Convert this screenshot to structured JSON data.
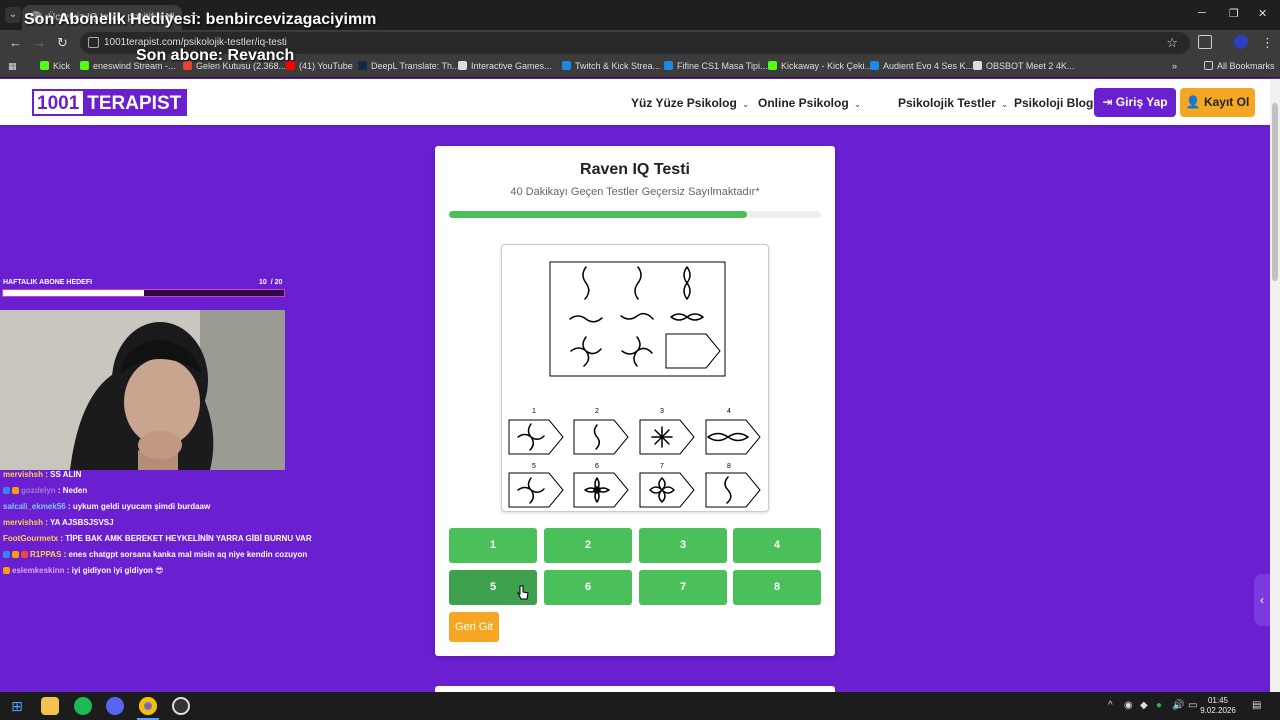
{
  "browser": {
    "tab_title": "Ücretsiz IQ testi - pozitif testi",
    "url": "1001terapist.com/psikolojik-testler/iq-testi",
    "bookmarks": [
      {
        "label": "Kick",
        "color": "#53fc18"
      },
      {
        "label": "eneswind Stream -...",
        "color": "#53fc18"
      },
      {
        "label": "Gelen Kutusu (2.368...",
        "color": "#ea4335"
      },
      {
        "label": "(41) YouTube",
        "color": "#ff0000"
      },
      {
        "label": "DeepL Translate: Th...",
        "color": "#0f2b46"
      },
      {
        "label": "Interactive Games...",
        "color": "#dddddd"
      },
      {
        "label": "Twitch & Kick Strea...",
        "color": "#1e88e5"
      },
      {
        "label": "Fifine CS1 Masa Tipi...",
        "color": "#1e88e5"
      },
      {
        "label": "Kickaway - Kick Çeki...",
        "color": "#53fc18"
      },
      {
        "label": "Audient Evo 4 Ses K...",
        "color": "#1e88e5"
      },
      {
        "label": "OBSBOT Meet 2 4K...",
        "color": "#dddddd"
      }
    ],
    "all_bookmarks": "All Bookmarks"
  },
  "site": {
    "logo_part1": "1001",
    "logo_part2": "TERAPIST",
    "menu": [
      "Yüz Yüze Psikolog",
      "Online Psikolog",
      "Psikolojik Testler",
      "Psikoloji Blog"
    ],
    "login": "Giriş Yap",
    "register": "Kayıt Ol",
    "brand_color": "#6a1fd0",
    "accent_color": "#f5a623"
  },
  "test": {
    "title": "Raven IQ Testi",
    "subtitle": "40 Dakikayı Geçen Testler Geçersiz Sayılmaktadır*",
    "progress": 0.8,
    "option_labels": [
      "1",
      "2",
      "3",
      "4",
      "5",
      "6",
      "7",
      "8"
    ],
    "answers": [
      "1",
      "2",
      "3",
      "4",
      "5",
      "6",
      "7",
      "8"
    ],
    "back": "Geri Git",
    "answer_color": "#4bbf5a"
  },
  "stream": {
    "gift_banner": "Son Abonelik Hediyesi: benbircevizagaciyimm",
    "last_sub": "Son abone: Revanch",
    "goal_label": "HAFTALIK ABONE HEDEFI",
    "goal_current": "10",
    "goal_total": "/ 20",
    "goal_progress": 0.5,
    "chat": [
      {
        "user": "mervishsh",
        "msg": "SS ALIN",
        "color": "#ffd24a"
      },
      {
        "user": "gozdelyn",
        "msg": "Neden",
        "color": "#a07ad8"
      },
      {
        "user": "salcali_ekmek56",
        "msg": "uykum geldi uyucam şimdi burdaaw",
        "color": "#7ec8ff"
      },
      {
        "user": "mervishsh",
        "msg": "YA AJSBSJSVSJ",
        "color": "#ffd24a"
      },
      {
        "user": "FootGourmetx",
        "msg": "TİPE BAK AMK BEREKET HEYKELİNİN YARRA GİBİ BURNU VAR",
        "color": "#ffd24a"
      },
      {
        "user": "R1PPAS",
        "msg": "enes chatgpt sorsana kanka mal misin aq niye kendin cozuyon",
        "color": "#ffd24a"
      },
      {
        "user": "eslemkeskinn",
        "msg": "iyi gidiyon iyi gidiyon 😎",
        "color": "#d9a6ff"
      }
    ]
  },
  "taskbar": {
    "time": "01:45",
    "date": "9.02.2026"
  }
}
